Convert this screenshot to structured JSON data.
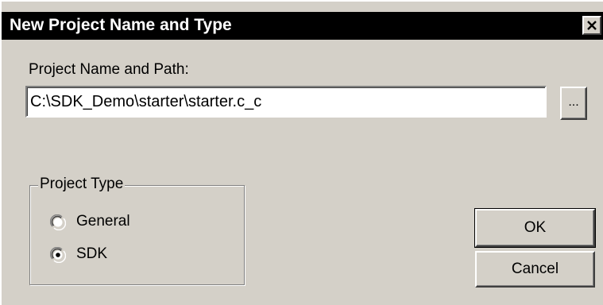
{
  "window": {
    "title": "New Project Name and Type",
    "close_glyph": "✕"
  },
  "path": {
    "label": "Project Name and Path:",
    "value": "C:\\SDK_Demo\\starter\\starter.c_c",
    "browse_label": "..."
  },
  "project_type": {
    "label": "Project Type",
    "options": [
      {
        "label": "General",
        "selected": false
      },
      {
        "label": "SDK",
        "selected": true
      }
    ]
  },
  "buttons": {
    "ok_label": "OK",
    "cancel_label": "Cancel"
  },
  "colors": {
    "face": "#d4d0c8",
    "titlebar": "#000000",
    "title_text": "#ffffff"
  }
}
